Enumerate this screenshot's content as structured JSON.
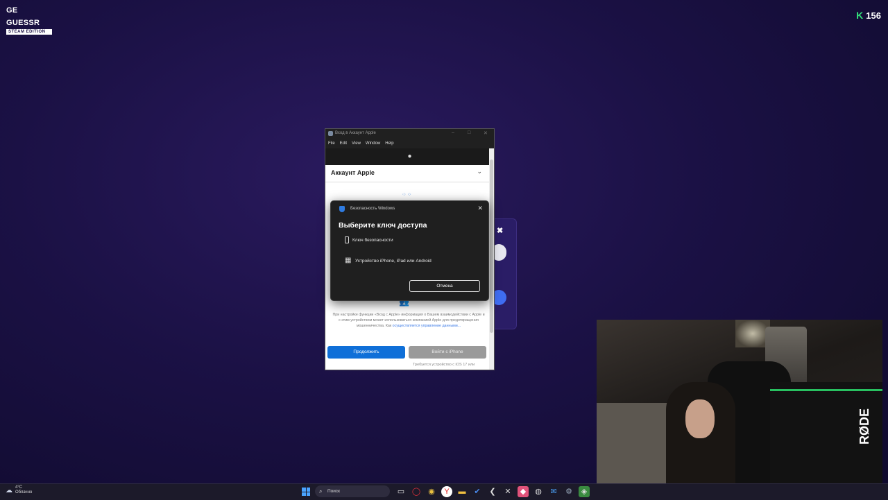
{
  "game": {
    "logo_line1": "GE GUESSR",
    "logo_line2": "STEAM EDITION",
    "coins_icon": "K",
    "coins": "156",
    "panel_close": "✖"
  },
  "apple_window": {
    "title": "Вход в Аккаунт Apple",
    "menu": [
      "File",
      "Edit",
      "View",
      "Window",
      "Help"
    ],
    "apple_logo": "",
    "header": "Аккаунт Apple",
    "info_text": "При настройке функции «Вход с Apple» информация о Вашем взаимодействии с Apple и с этим устройством может использоваться компанией Apple для предотвращения мошенничества. Как",
    "info_link": "осуществляется управление данными...",
    "continue_button": "Продолжить",
    "phone_button": "Войти с iPhone",
    "footer": "Требуется устройство с iOS 17 или"
  },
  "security_dialog": {
    "caption": "Безопасность Windows",
    "heading": "Выберите ключ доступа",
    "options": [
      {
        "label": "Ключ безопасности",
        "icon": "usb-key-icon"
      },
      {
        "label": "Устройство iPhone, iPad или Android",
        "icon": "qr-code-icon"
      }
    ],
    "cancel": "Отмена",
    "close": "✕"
  },
  "taskbar": {
    "temperature": "4°C",
    "weather": "Облачно",
    "search_placeholder": "Поиск"
  },
  "webcam": {
    "mic_brand": "RØDE"
  }
}
